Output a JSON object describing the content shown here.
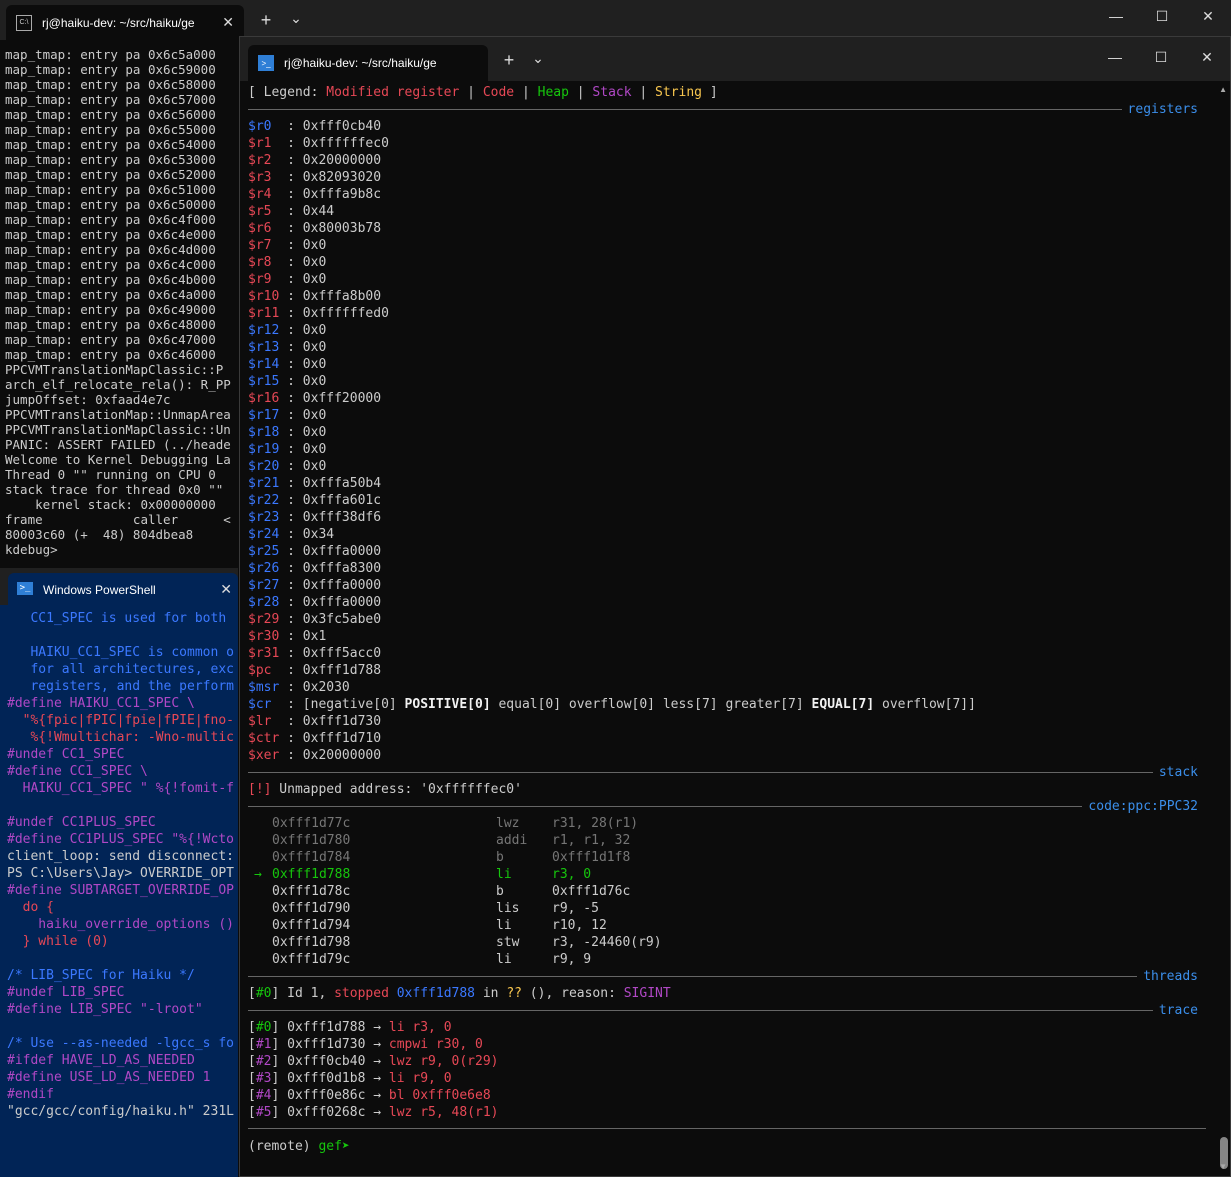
{
  "back_window": {
    "tab_title": "rj@haiku-dev: ~/src/haiku/ge",
    "new_tab": "+",
    "dropdown": "⌄",
    "lines": [
      "map_tmap: entry pa 0x6c5a000 ",
      "map_tmap: entry pa 0x6c59000 ",
      "map_tmap: entry pa 0x6c58000 ",
      "map_tmap: entry pa 0x6c57000 ",
      "map_tmap: entry pa 0x6c56000 ",
      "map_tmap: entry pa 0x6c55000 ",
      "map_tmap: entry pa 0x6c54000 ",
      "map_tmap: entry pa 0x6c53000 ",
      "map_tmap: entry pa 0x6c52000 ",
      "map_tmap: entry pa 0x6c51000 ",
      "map_tmap: entry pa 0x6c50000 ",
      "map_tmap: entry pa 0x6c4f000 ",
      "map_tmap: entry pa 0x6c4e000 ",
      "map_tmap: entry pa 0x6c4d000 ",
      "map_tmap: entry pa 0x6c4c000 ",
      "map_tmap: entry pa 0x6c4b000 ",
      "map_tmap: entry pa 0x6c4a000 ",
      "map_tmap: entry pa 0x6c49000 ",
      "map_tmap: entry pa 0x6c48000 ",
      "map_tmap: entry pa 0x6c47000 ",
      "map_tmap: entry pa 0x6c46000 ",
      "PPCVMTranslationMapClassic::P",
      "arch_elf_relocate_rela(): R_PP",
      "jumpOffset: 0xfaad4e7c",
      "PPCVMTranslationMap::UnmapArea",
      "PPCVMTranslationMapClassic::Un",
      "PANIC: ASSERT FAILED (../heade",
      "Welcome to Kernel Debugging La",
      "Thread 0 \"\" running on CPU 0",
      "stack trace for thread 0x0 \"\"",
      "    kernel stack: 0x00000000 ",
      "frame            caller      <",
      "80003c60 (+  48) 804dbea8",
      "kdebug>"
    ]
  },
  "powershell": {
    "tab_title": "Windows PowerShell",
    "lines": [
      {
        "t": "   CC1_SPEC is used for both ",
        "c": "#3b78ff"
      },
      {
        "t": "",
        "c": "#ccc"
      },
      {
        "t": "   HAIKU_CC1_SPEC is common o",
        "c": "#3b78ff"
      },
      {
        "t": "   for all architectures, exc",
        "c": "#3b78ff"
      },
      {
        "t": "   registers, and the perform",
        "c": "#3b78ff"
      },
      {
        "t": "#define HAIKU_CC1_SPEC \\",
        "c": "#b148c6"
      },
      {
        "t": "  \"%{fpic|fPIC|fpie|fPIE|fno-",
        "c": "#e74856"
      },
      {
        "t": "   %{!Wmultichar: -Wno-multic",
        "c": "#e74856"
      },
      {
        "t": "#undef CC1_SPEC",
        "c": "#b148c6"
      },
      {
        "t": "#define CC1_SPEC \\",
        "c": "#b148c6"
      },
      {
        "t": "  HAIKU_CC1_SPEC \" %{!fomit-f",
        "c": "#b148c6"
      },
      {
        "t": "",
        "c": "#ccc"
      },
      {
        "t": "#undef CC1PLUS_SPEC",
        "c": "#b148c6"
      },
      {
        "t": "#define CC1PLUS_SPEC \"%{!Wcto",
        "c": "#b148c6"
      },
      {
        "t": "client_loop: send disconnect:",
        "c": "#cccccc"
      },
      {
        "t": "PS C:\\Users\\Jay> OVERRIDE_OPT",
        "c": "#cccccc"
      },
      {
        "t": "#define SUBTARGET_OVERRIDE_OP",
        "c": "#b148c6"
      },
      {
        "t": "  do {",
        "c": "#e74856"
      },
      {
        "t": "    haiku_override_options ()",
        "c": "#b148c6"
      },
      {
        "t": "  } while (0)",
        "c": "#e74856"
      },
      {
        "t": "",
        "c": "#ccc"
      },
      {
        "t": "/* LIB_SPEC for Haiku */",
        "c": "#3b78ff"
      },
      {
        "t": "#undef LIB_SPEC",
        "c": "#b148c6"
      },
      {
        "t": "#define LIB_SPEC \"-lroot\"",
        "c": "#b148c6"
      },
      {
        "t": "",
        "c": "#ccc"
      },
      {
        "t": "/* Use --as-needed -lgcc_s fo",
        "c": "#3b78ff"
      },
      {
        "t": "#ifdef HAVE_LD_AS_NEEDED",
        "c": "#b148c6"
      },
      {
        "t": "#define USE_LD_AS_NEEDED 1",
        "c": "#b148c6"
      },
      {
        "t": "#endif",
        "c": "#b148c6"
      },
      {
        "t": "\"gcc/gcc/config/haiku.h\" 231L",
        "c": "#cccccc"
      }
    ]
  },
  "front_window": {
    "tab_title": "rj@haiku-dev: ~/src/haiku/ge",
    "new_tab": "+",
    "dropdown": "⌄",
    "legend": {
      "open": "[ Legend: ",
      "modified": "Modified register",
      "bar": " | ",
      "code": "Code",
      "heap": "Heap",
      "stack": "Stack",
      "string": "String",
      "close": " ]"
    },
    "sections": {
      "registers": "registers",
      "stack": "stack",
      "code": "code:ppc:PPC32",
      "threads": "threads",
      "trace": "trace"
    },
    "registers": [
      {
        "name": "$r0  ",
        "value": "0xfff0cb40",
        "mod": false
      },
      {
        "name": "$r1  ",
        "value": "0xffffffec0",
        "mod": true
      },
      {
        "name": "$r2  ",
        "value": "0x20000000",
        "mod": true
      },
      {
        "name": "$r3  ",
        "value": "0x82093020",
        "mod": true
      },
      {
        "name": "$r4  ",
        "value": "0xfffa9b8c",
        "mod": true
      },
      {
        "name": "$r5  ",
        "value": "0x44",
        "mod": true
      },
      {
        "name": "$r6  ",
        "value": "0x80003b78",
        "mod": true
      },
      {
        "name": "$r7  ",
        "value": "0x0",
        "mod": true
      },
      {
        "name": "$r8  ",
        "value": "0x0",
        "mod": true
      },
      {
        "name": "$r9  ",
        "value": "0x0",
        "mod": true
      },
      {
        "name": "$r10 ",
        "value": "0xfffa8b00",
        "mod": true
      },
      {
        "name": "$r11 ",
        "value": "0xffffffed0",
        "mod": true
      },
      {
        "name": "$r12 ",
        "value": "0x0",
        "mod": false
      },
      {
        "name": "$r13 ",
        "value": "0x0",
        "mod": false
      },
      {
        "name": "$r14 ",
        "value": "0x0",
        "mod": false
      },
      {
        "name": "$r15 ",
        "value": "0x0",
        "mod": false
      },
      {
        "name": "$r16 ",
        "value": "0xfff20000",
        "mod": true
      },
      {
        "name": "$r17 ",
        "value": "0x0",
        "mod": false
      },
      {
        "name": "$r18 ",
        "value": "0x0",
        "mod": false
      },
      {
        "name": "$r19 ",
        "value": "0x0",
        "mod": false
      },
      {
        "name": "$r20 ",
        "value": "0x0",
        "mod": false
      },
      {
        "name": "$r21 ",
        "value": "0xfffa50b4",
        "mod": false
      },
      {
        "name": "$r22 ",
        "value": "0xfffa601c",
        "mod": false
      },
      {
        "name": "$r23 ",
        "value": "0xfff38df6",
        "mod": false
      },
      {
        "name": "$r24 ",
        "value": "0x34",
        "mod": false
      },
      {
        "name": "$r25 ",
        "value": "0xfffa0000",
        "mod": false
      },
      {
        "name": "$r26 ",
        "value": "0xfffa8300",
        "mod": false
      },
      {
        "name": "$r27 ",
        "value": "0xfffa0000",
        "mod": false
      },
      {
        "name": "$r28 ",
        "value": "0xfffa0000",
        "mod": false
      },
      {
        "name": "$r29 ",
        "value": "0x3fc5abe0",
        "mod": true
      },
      {
        "name": "$r30 ",
        "value": "0x1",
        "mod": true
      },
      {
        "name": "$r31 ",
        "value": "0xfff5acc0",
        "mod": true
      },
      {
        "name": "$pc  ",
        "value": "0xfff1d788",
        "mod": true
      },
      {
        "name": "$msr ",
        "value": "0x2030",
        "mod": false
      },
      {
        "name": "$cr  ",
        "value": "",
        "mod": false,
        "flags": true
      },
      {
        "name": "$lr  ",
        "value": "0xfff1d730",
        "mod": true
      },
      {
        "name": "$ctr ",
        "value": "0xfff1d710",
        "mod": true
      },
      {
        "name": "$xer ",
        "value": "0x20000000",
        "mod": true
      }
    ],
    "cr_flags": [
      {
        "t": "[negative[0] ",
        "b": false
      },
      {
        "t": "POSITIVE[0]",
        "b": true
      },
      {
        "t": " equal[0] overflow[0] less[7] greater[7] ",
        "b": false
      },
      {
        "t": "EQUAL[7]",
        "b": true
      },
      {
        "t": " overflow[7]]",
        "b": false
      }
    ],
    "stack_msg": {
      "tag": "[!]",
      "text": " Unmapped address: '0xffffffec0'"
    },
    "code": [
      {
        "arrow": "  ",
        "addr": "0xfff1d77c",
        "op": "lwz",
        "args": "r31, 28(r1)",
        "state": "past"
      },
      {
        "arrow": "  ",
        "addr": "0xfff1d780",
        "op": "addi",
        "args": "r1, r1, 32",
        "state": "past"
      },
      {
        "arrow": "  ",
        "addr": "0xfff1d784",
        "op": "b",
        "args": "0xfff1d1f8",
        "state": "past"
      },
      {
        "arrow": "→ ",
        "addr": "0xfff1d788",
        "op": "li",
        "args": "r3, 0",
        "state": "current"
      },
      {
        "arrow": "  ",
        "addr": "0xfff1d78c",
        "op": "b",
        "args": "0xfff1d76c",
        "state": "next"
      },
      {
        "arrow": "  ",
        "addr": "0xfff1d790",
        "op": "lis",
        "args": "r9, -5",
        "state": "next"
      },
      {
        "arrow": "  ",
        "addr": "0xfff1d794",
        "op": "li",
        "args": "r10, 12",
        "state": "next"
      },
      {
        "arrow": "  ",
        "addr": "0xfff1d798",
        "op": "stw",
        "args": "r3, -24460(r9)",
        "state": "next"
      },
      {
        "arrow": "  ",
        "addr": "0xfff1d79c",
        "op": "li",
        "args": "r9, 9",
        "state": "next"
      }
    ],
    "thread": {
      "open": "[",
      "id_tag": "#0",
      "close": "] Id 1, ",
      "stopped": "stopped",
      "addr": "0xfff1d788",
      "in": " in ",
      "func": "??",
      "rest": " (), reason: ",
      "reason": "SIGINT"
    },
    "trace": [
      {
        "n": "#0",
        "addr": "0xfff1d788",
        "insn": "li r3, 0"
      },
      {
        "n": "#1",
        "addr": "0xfff1d730",
        "insn": "cmpwi r30, 0"
      },
      {
        "n": "#2",
        "addr": "0xfff0cb40",
        "insn": "lwz r9, 0(r29)"
      },
      {
        "n": "#3",
        "addr": "0xfff0d1b8",
        "insn": "li r9, 0"
      },
      {
        "n": "#4",
        "addr": "0xfff0e86c",
        "insn": "bl 0xfff0e6e8"
      },
      {
        "n": "#5",
        "addr": "0xfff0268c",
        "insn": "lwz r5, 48(r1)"
      }
    ],
    "prompt": {
      "remote": "(remote) ",
      "gef": "gef➤"
    }
  },
  "colors": {
    "register_blue": "#3b78ff",
    "register_modified": "#e74856",
    "code": "#e74856",
    "heap": "#16c60c",
    "stack": "#b148c6",
    "string": "#f9c74f",
    "section_label": "#3b8eea",
    "powershell_bg": "#012456"
  }
}
